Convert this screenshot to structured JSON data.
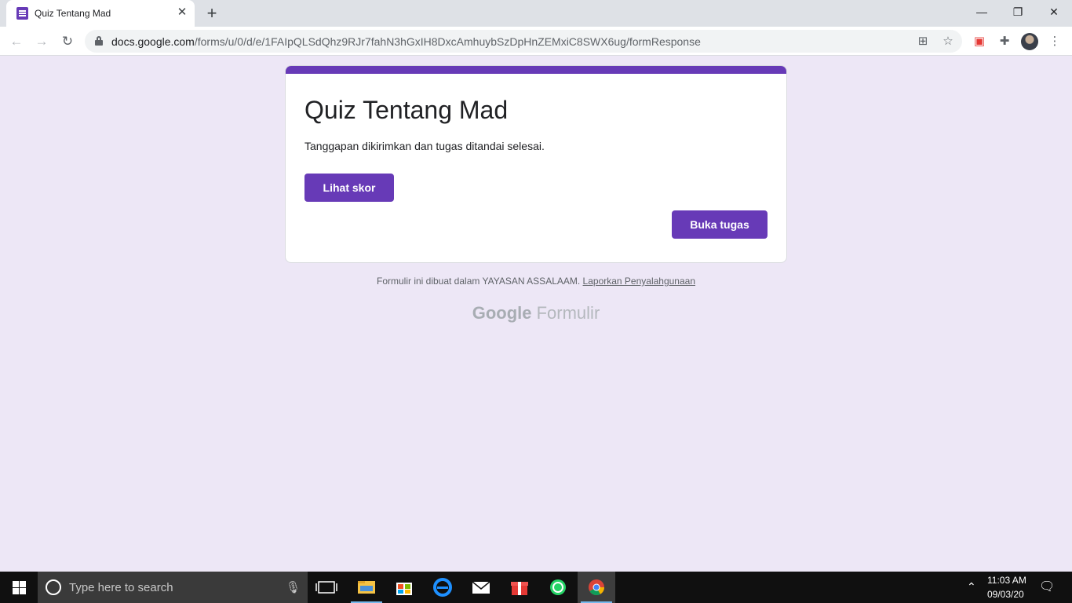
{
  "browser": {
    "tab": {
      "title": "Quiz Tentang Mad",
      "favicon": "google-forms-icon"
    },
    "address": {
      "domain": "docs.google.com",
      "path": "/forms/u/0/d/e/1FAIpQLSdQhz9RJr7fahN3hGxIH8DxcAmhuybSzDpHnZEMxiC8SWX6ug/formResponse"
    }
  },
  "form": {
    "title": "Quiz Tentang Mad",
    "message": "Tanggapan dikirimkan dan tugas ditandai selesai.",
    "view_score_label": "Lihat skor",
    "open_task_label": "Buka tugas",
    "accent_color": "#673ab7",
    "background_color": "#ede7f6"
  },
  "footer": {
    "note": "Formulir ini dibuat dalam YAYASAN ASSALAAM.",
    "abuse_link": "Laporkan Penyalahgunaan",
    "brand_google": "Google",
    "brand_product": "Formulir"
  },
  "taskbar": {
    "search_placeholder": "Type here to search",
    "time": "11:03 AM",
    "date": "09/03/20"
  }
}
